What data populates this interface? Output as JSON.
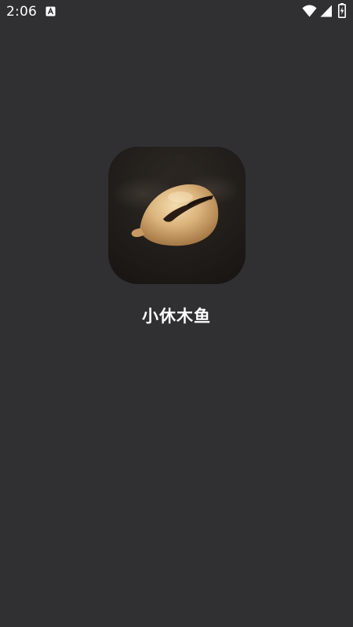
{
  "status_bar": {
    "time": "2:06",
    "notification_icon": "android-a-icon",
    "wifi_icon": "wifi-icon",
    "signal_icon": "cell-signal-icon",
    "battery_icon": "battery-charging-icon"
  },
  "splash": {
    "icon": "wooden-fish-app-icon",
    "app_name": "小休木鱼"
  },
  "colors": {
    "background": "#303033",
    "text": "#ffffff",
    "icon_bg": "#1f1b18",
    "woodfish": "#d8b07a"
  }
}
